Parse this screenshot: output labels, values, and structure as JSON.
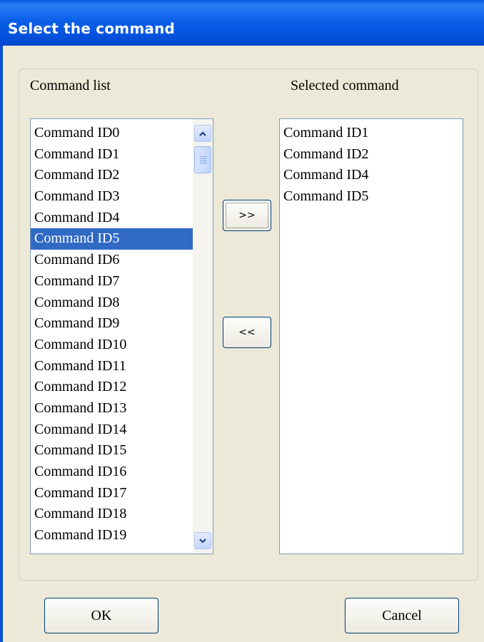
{
  "window": {
    "title": "Select the command"
  },
  "command_list": {
    "label": "Command list",
    "items": [
      "Command ID0",
      "Command ID1",
      "Command ID2",
      "Command ID3",
      "Command ID4",
      "Command ID5",
      "Command ID6",
      "Command ID7",
      "Command ID8",
      "Command ID9",
      "Command ID10",
      "Command ID11",
      "Command ID12",
      "Command ID13",
      "Command ID14",
      "Command ID15",
      "Command ID16",
      "Command ID17",
      "Command ID18",
      "Command ID19"
    ],
    "selected_index": 5
  },
  "selected_command": {
    "label": "Selected command",
    "items": [
      "Command ID1",
      "Command ID2",
      "Command ID4",
      "Command ID5"
    ]
  },
  "buttons": {
    "add": ">>",
    "remove": "<<",
    "ok": "OK",
    "cancel": "Cancel"
  },
  "icons": {
    "scroll_up": "scroll-up-arrow-icon",
    "scroll_down": "scroll-down-arrow-icon"
  },
  "colors": {
    "titlebar": "#0a5fe8",
    "selection": "#316ac5",
    "dialog_bg": "#ece9d8"
  }
}
